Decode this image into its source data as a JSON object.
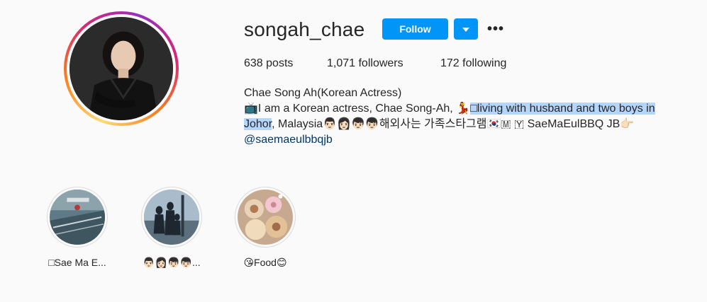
{
  "profile": {
    "username": "songah_chae",
    "follow_label": "Follow",
    "more_label": "•••"
  },
  "stats": {
    "posts": "638 posts",
    "followers": "1,071 followers",
    "following": "172 following"
  },
  "bio": {
    "name": "Chae Song Ah(Korean Actress)",
    "line_part1": "📺I am a Korean actress, Chae Song-Ah, 💃",
    "line_highlighted": "□living with husband and two boys in Johor",
    "line_part2": ", Malaysia👨🏻👩🏻👦🏻👦🏻해외사는 가족스타그램🇰🇷🇲 🇾 SaeMaEulBBQ JB👉🏻",
    "link": "@saemaeulbbqjb"
  },
  "highlights": [
    {
      "label": "□Sae Ma E..."
    },
    {
      "label": "👨🏻👩🏻👦🏻👦🏻..."
    },
    {
      "label": "😘Food😊"
    }
  ],
  "colors": {
    "accent": "#0095f6",
    "selection": "#b4d5fe",
    "link": "#00376b",
    "text": "#262626"
  },
  "icons": {
    "dropdown": "chevron-down-icon",
    "more": "more-options-icon"
  }
}
